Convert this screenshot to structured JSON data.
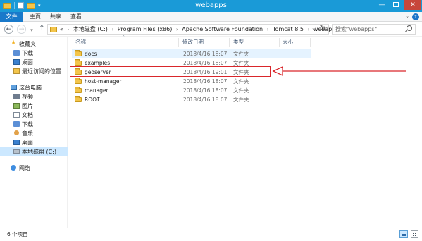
{
  "window": {
    "title": "webapps"
  },
  "ribbon": {
    "tabs": [
      "文件",
      "主页",
      "共享",
      "查看"
    ]
  },
  "address": {
    "crumbs": [
      "本地磁盘 (C:)",
      "Program Files (x86)",
      "Apache Software Foundation",
      "Tomcat 8.5",
      "webapps"
    ],
    "lead": "«"
  },
  "search": {
    "placeholder": "搜索\"webapps\""
  },
  "nav": {
    "quick_access": "收藏夹",
    "quick_items": [
      "下载",
      "桌面",
      "最近访问的位置"
    ],
    "this_pc": "这台电脑",
    "pc_items": [
      "视频",
      "图片",
      "文档",
      "下载",
      "音乐",
      "桌面",
      "本地磁盘 (C:)"
    ],
    "network": "网络"
  },
  "columns": {
    "name": "名称",
    "date": "修改日期",
    "type": "类型",
    "size": "大小"
  },
  "files": [
    {
      "name": "docs",
      "date": "2018/4/16 18:07",
      "type": "文件夹"
    },
    {
      "name": "examples",
      "date": "2018/4/16 18:07",
      "type": "文件夹"
    },
    {
      "name": "geoserver",
      "date": "2018/4/16 19:01",
      "type": "文件夹"
    },
    {
      "name": "host-manager",
      "date": "2018/4/16 18:07",
      "type": "文件夹"
    },
    {
      "name": "manager",
      "date": "2018/4/16 18:07",
      "type": "文件夹"
    },
    {
      "name": "ROOT",
      "date": "2018/4/16 18:07",
      "type": "文件夹"
    }
  ],
  "status": {
    "count": "6 个项目"
  },
  "annotation": {
    "color": "#d9262b",
    "highlighted_item": "geoserver"
  },
  "colors": {
    "titlebar": "#1a9ad7",
    "file_tab": "#1979ca",
    "selection": "#cce8ff",
    "folder": "#f3c54b"
  }
}
